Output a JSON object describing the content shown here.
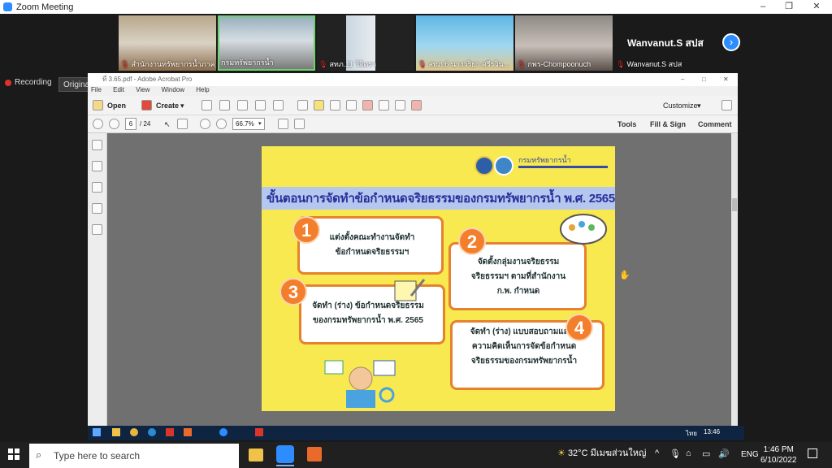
{
  "zoom": {
    "title": "Zoom Meeting",
    "window_controls": [
      "–",
      "❐",
      "✕"
    ],
    "recording_label": "Recording",
    "original_sound_label": "Original Sound: Off",
    "participants": [
      {
        "name": "สำนักงานทรัพยากรน้ำภาค..."
      },
      {
        "name": "กรมทรัพยากรน้ำ"
      },
      {
        "name": "สทภ.11 วิจิตรา"
      },
      {
        "name": "สทภ.6 นางวริยา ศรีรวิน..."
      },
      {
        "name": "กพร-Chompoonuch"
      },
      {
        "name": "Wanvanut.S สปส"
      }
    ],
    "speaker_tile_name": "Wanvanut.S สปส",
    "next_icon": "chevron-right-icon"
  },
  "acrobat": {
    "title": "ที่ 3.65.pdf - Adobe Acrobat Pro",
    "menu": [
      "File",
      "Edit",
      "View",
      "Window",
      "Help"
    ],
    "toolbar": {
      "open_label": "Open",
      "create_label": "Create",
      "customize_label": "Customize"
    },
    "nav": {
      "page_current": "6",
      "page_total": "/ 24",
      "zoom": "66.7%",
      "tools_label": "Tools",
      "fill_sign_label": "Fill & Sign",
      "comment_label": "Comment"
    }
  },
  "slide": {
    "logo_text": "กรมทรัพยากรน้ำ",
    "title": "ขั้นตอนการจัดทำข้อกำหนดจริยธรรมของกรมทรัพยากรน้ำ พ.ศ. 2565",
    "steps": [
      {
        "num": "1",
        "line1": "แต่งตั้งคณะทำงานจัดทำ",
        "line2": "ข้อกำหนดจริยธรรมฯ"
      },
      {
        "num": "2",
        "line1": "จัดตั้งกลุ่มงานจริยธรรม",
        "line2": "จริยธรรมฯ ตามที่สำนักงาน",
        "line3": "ก.พ. กำหนด"
      },
      {
        "num": "3",
        "line1": "จัดทำ (ร่าง) ข้อกำหนดจริยธรรม",
        "line2": "ของกรมทรัพยากรน้ำ พ.ศ. 2565"
      },
      {
        "num": "4",
        "line1": "จัดทำ (ร่าง) แบบสอบถามแสดง",
        "line2": "ความคิดเห็นการจัดข้อกำหนด",
        "line3": "จริยธรรมของกรมทรัพยากรน้ำ"
      }
    ]
  },
  "inner_taskbar": {
    "time": "13:46",
    "lang": "ไทย"
  },
  "taskbar": {
    "search_placeholder": "Type here to search",
    "weather": "32°C  มีเมฆส่วนใหญ่",
    "lang": "ENG",
    "time": "1:46 PM",
    "date": "6/10/2022"
  }
}
